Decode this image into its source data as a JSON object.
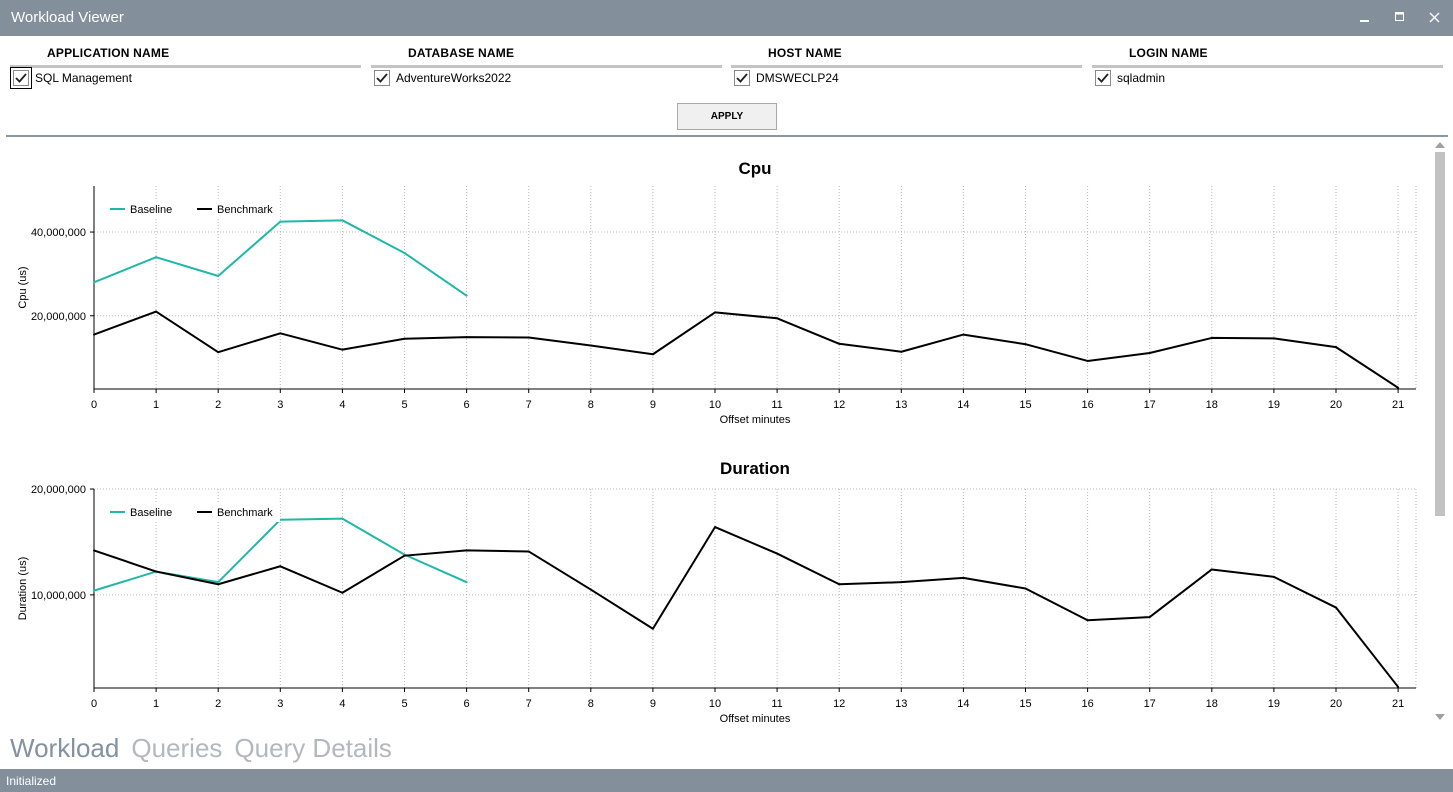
{
  "window": {
    "title": "Workload Viewer"
  },
  "filters": [
    {
      "header": "APPLICATION NAME",
      "value": "SQL Management",
      "checked": true
    },
    {
      "header": "DATABASE NAME",
      "value": "AdventureWorks2022",
      "checked": true
    },
    {
      "header": "HOST NAME",
      "value": "DMSWECLP24",
      "checked": true
    },
    {
      "header": "LOGIN NAME",
      "value": "sqladmin",
      "checked": true
    }
  ],
  "apply_label": "APPLY",
  "tabs": [
    {
      "label": "Workload",
      "active": true
    },
    {
      "label": "Queries",
      "active": false
    },
    {
      "label": "Query Details",
      "active": false
    }
  ],
  "status": "Initialized",
  "colors": {
    "baseline": "#1fb8a8",
    "benchmark": "#000000",
    "chrome": "#838f9b"
  },
  "chart_data": [
    {
      "type": "line",
      "title": "Cpu",
      "xlabel": "Offset minutes",
      "ylabel": "Cpu (us)",
      "x": [
        0,
        1,
        2,
        3,
        4,
        5,
        6,
        7,
        8,
        9,
        10,
        11,
        12,
        13,
        14,
        15,
        16,
        17,
        18,
        19,
        20,
        21
      ],
      "ylim": [
        2500000,
        51000000
      ],
      "yticks": [
        20000000,
        40000000
      ],
      "ytick_labels": [
        "20,000,000",
        "40,000,000"
      ],
      "legend": "top-left",
      "grid": true,
      "series": [
        {
          "name": "Baseline",
          "x": [
            0,
            1,
            2,
            3,
            4,
            5,
            6
          ],
          "values": [
            28000000,
            34000000,
            29500000,
            42500000,
            42800000,
            35000000,
            24800000
          ]
        },
        {
          "name": "Benchmark",
          "x": [
            0,
            1,
            2,
            3,
            4,
            5,
            6,
            7,
            8,
            9,
            10,
            11,
            12,
            13,
            14,
            15,
            16,
            17,
            18,
            19,
            20,
            21
          ],
          "values": [
            15500000,
            21000000,
            11300000,
            15800000,
            11900000,
            14500000,
            14900000,
            14800000,
            12900000,
            10800000,
            20800000,
            19400000,
            13300000,
            11400000,
            15500000,
            13200000,
            9200000,
            11100000,
            14700000,
            14600000,
            12500000,
            2800000
          ]
        }
      ]
    },
    {
      "type": "line",
      "title": "Duration",
      "xlabel": "Offset minutes",
      "ylabel": "Duration (us)",
      "x": [
        0,
        1,
        2,
        3,
        4,
        5,
        6,
        7,
        8,
        9,
        10,
        11,
        12,
        13,
        14,
        15,
        16,
        17,
        18,
        19,
        20,
        21
      ],
      "ylim": [
        1200000,
        20000000
      ],
      "yticks": [
        10000000,
        20000000
      ],
      "ytick_labels": [
        "10,000,000",
        "20,000,000"
      ],
      "legend": "top-left",
      "grid": true,
      "series": [
        {
          "name": "Baseline",
          "x": [
            0,
            1,
            2,
            3,
            4,
            5,
            6
          ],
          "values": [
            10400000,
            12200000,
            11200000,
            17100000,
            17200000,
            13800000,
            11200000
          ]
        },
        {
          "name": "Benchmark",
          "x": [
            0,
            1,
            2,
            3,
            4,
            5,
            6,
            7,
            8,
            9,
            10,
            11,
            12,
            13,
            14,
            15,
            16,
            17,
            18,
            19,
            20,
            21
          ],
          "values": [
            14200000,
            12200000,
            11000000,
            12700000,
            10200000,
            13700000,
            14200000,
            14100000,
            10500000,
            6800000,
            16400000,
            13900000,
            11000000,
            11200000,
            11600000,
            10600000,
            7600000,
            7900000,
            12400000,
            11700000,
            8800000,
            1300000
          ]
        }
      ]
    }
  ]
}
